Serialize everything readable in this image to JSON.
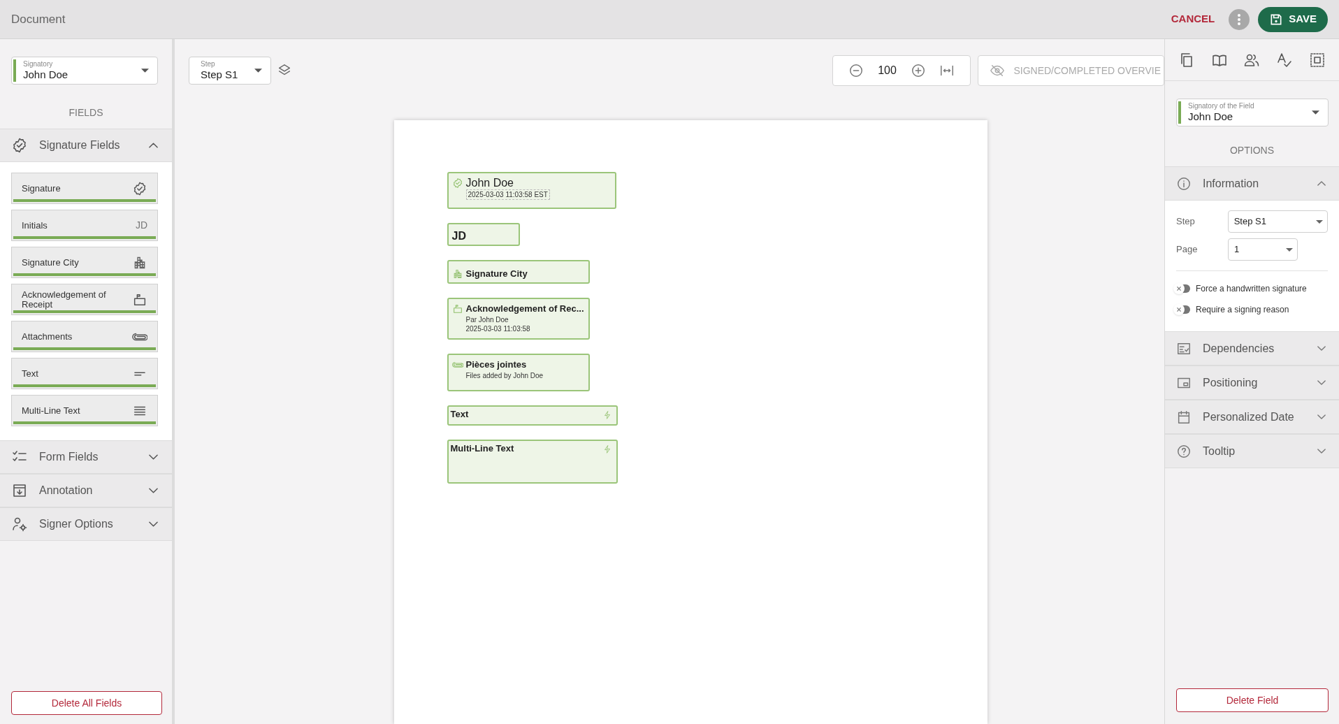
{
  "header": {
    "title": "Document",
    "cancel": "CANCEL",
    "save": "SAVE"
  },
  "left": {
    "signatory": {
      "label": "Signatory",
      "value": "John Doe"
    },
    "heading": "FIELDS",
    "sections": [
      {
        "kind": "signature",
        "label": "Signature Fields",
        "expanded": true,
        "items": [
          {
            "kind": "signature",
            "label": "Signature"
          },
          {
            "kind": "initials",
            "label": "Initials",
            "badge": "JD"
          },
          {
            "kind": "city",
            "label": "Signature City"
          },
          {
            "kind": "acknowledgement",
            "label": "Acknowledgement of Receipt"
          },
          {
            "kind": "attachment",
            "label": "Attachments"
          },
          {
            "kind": "text",
            "label": "Text"
          },
          {
            "kind": "multiline",
            "label": "Multi-Line Text"
          }
        ]
      },
      {
        "kind": "form",
        "label": "Form Fields",
        "expanded": false
      },
      {
        "kind": "annotation",
        "label": "Annotation",
        "expanded": false
      },
      {
        "kind": "signer",
        "label": "Signer Options",
        "expanded": false
      }
    ],
    "delete_button": "Delete All Fields"
  },
  "toolbar": {
    "step": {
      "label": "Step",
      "value": "Step S1"
    },
    "zoom": "100",
    "overview_button": "SIGNED/COMPLETED OVERVIE"
  },
  "document": {
    "fields": [
      {
        "kind": "signature",
        "title": "John Doe",
        "lines": [
          "2025-03-03 11:03:58 EST"
        ]
      },
      {
        "kind": "initials",
        "title": "JD"
      },
      {
        "kind": "city",
        "title": "Signature City"
      },
      {
        "kind": "acknowledgement",
        "title": "Acknowledgement of Rec...",
        "lines": [
          "Par John Doe",
          "2025-03-03 11:03:58"
        ]
      },
      {
        "kind": "attachment",
        "title": "Pièces jointes",
        "lines": [
          "Files added by John Doe"
        ]
      },
      {
        "kind": "text",
        "title": "Text"
      },
      {
        "kind": "multiline",
        "title": "Multi-Line Text"
      }
    ]
  },
  "right": {
    "signatory": {
      "label": "Signatory of the Field",
      "value": "John Doe"
    },
    "heading": "OPTIONS",
    "sections": [
      {
        "kind": "information",
        "label": "Information",
        "expanded": true,
        "rows": [
          {
            "label": "Step",
            "value": "Step S1"
          },
          {
            "label": "Page",
            "value": "1"
          }
        ],
        "toggles": [
          {
            "label": "Force a handwritten signature",
            "checked": false
          },
          {
            "label": "Require a signing reason",
            "checked": false
          }
        ]
      },
      {
        "kind": "dependencies",
        "label": "Dependencies",
        "expanded": false
      },
      {
        "kind": "positioning",
        "label": "Positioning",
        "expanded": false
      },
      {
        "kind": "date",
        "label": "Personalized Date",
        "expanded": false
      },
      {
        "kind": "tooltip",
        "label": "Tooltip",
        "expanded": false
      }
    ],
    "delete_button": "Delete Field"
  }
}
